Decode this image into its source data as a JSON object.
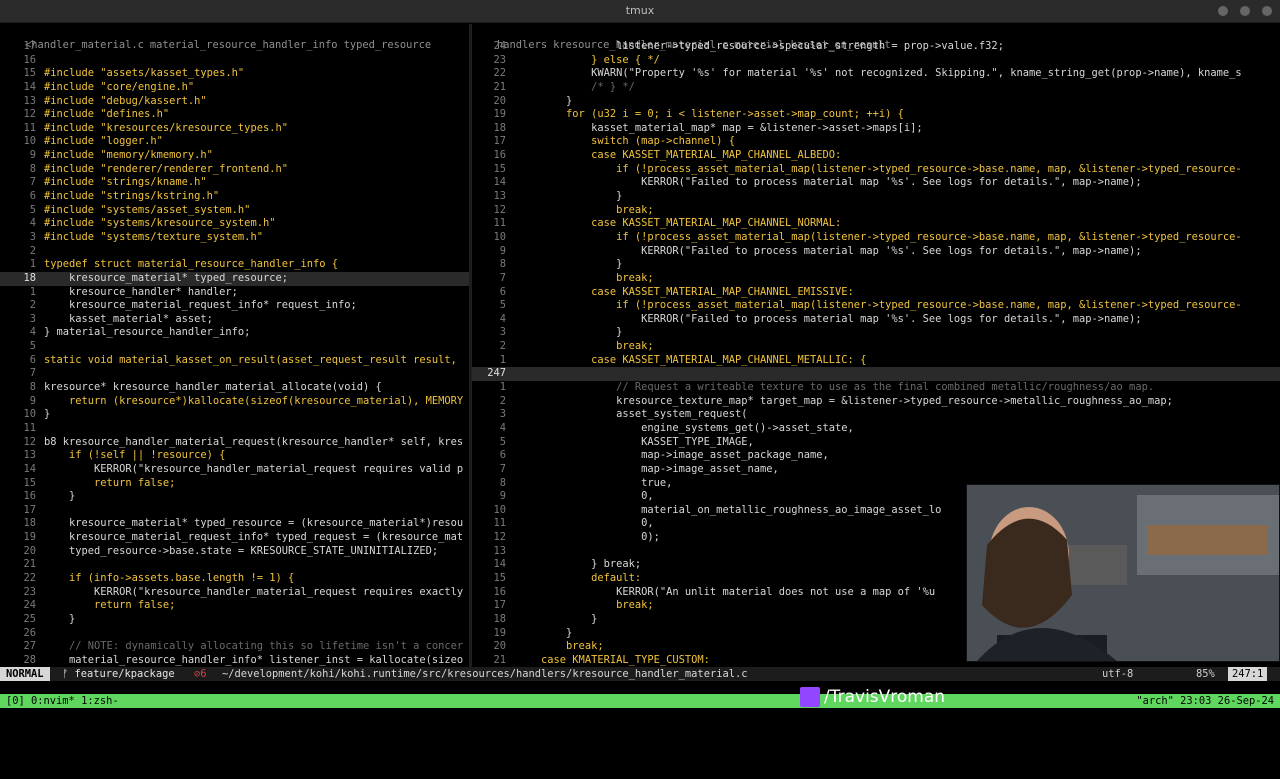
{
  "window": {
    "title": "tmux"
  },
  "left_pane": {
    "breadcrumbs": [
      "<handler_material.c",
      "material_resource_handler_info",
      "typed_resource"
    ],
    "lines": [
      {
        "n": "17",
        "t": ""
      },
      {
        "n": "16",
        "t": ""
      },
      {
        "n": "15",
        "t": "#include \"assets/kasset_types.h\""
      },
      {
        "n": "14",
        "t": "#include \"core/engine.h\""
      },
      {
        "n": "13",
        "t": "#include \"debug/kassert.h\""
      },
      {
        "n": "12",
        "t": "#include \"defines.h\""
      },
      {
        "n": "11",
        "t": "#include \"kresources/kresource_types.h\""
      },
      {
        "n": "10",
        "t": "#include \"logger.h\""
      },
      {
        "n": "9",
        "t": "#include \"memory/kmemory.h\""
      },
      {
        "n": "8",
        "t": "#include \"renderer/renderer_frontend.h\""
      },
      {
        "n": "7",
        "t": "#include \"strings/kname.h\""
      },
      {
        "n": "6",
        "t": "#include \"strings/kstring.h\""
      },
      {
        "n": "5",
        "t": "#include \"systems/asset_system.h\""
      },
      {
        "n": "4",
        "t": "#include \"systems/kresource_system.h\""
      },
      {
        "n": "3",
        "t": "#include \"systems/texture_system.h\""
      },
      {
        "n": "2",
        "t": ""
      },
      {
        "n": "1",
        "t": "typedef struct material_resource_handler_info {"
      },
      {
        "n": "18",
        "t": "    kresource_material* typed_resource;",
        "cur": true
      },
      {
        "n": "1",
        "t": "    kresource_handler* handler;"
      },
      {
        "n": "2",
        "t": "    kresource_material_request_info* request_info;"
      },
      {
        "n": "3",
        "t": "    kasset_material* asset;"
      },
      {
        "n": "4",
        "t": "} material_resource_handler_info;"
      },
      {
        "n": "5",
        "t": ""
      },
      {
        "n": "6",
        "t": "static void material_kasset_on_result(asset_request_result result,"
      },
      {
        "n": "7",
        "t": ""
      },
      {
        "n": "8",
        "t": "kresource* kresource_handler_material_allocate(void) {"
      },
      {
        "n": "9",
        "t": "    return (kresource*)kallocate(sizeof(kresource_material), MEMORY"
      },
      {
        "n": "10",
        "t": "}"
      },
      {
        "n": "11",
        "t": ""
      },
      {
        "n": "12",
        "t": "b8 kresource_handler_material_request(kresource_handler* self, kres"
      },
      {
        "n": "13",
        "t": "    if (!self || !resource) {"
      },
      {
        "n": "14",
        "t": "        KERROR(\"kresource_handler_material_request requires valid p"
      },
      {
        "n": "15",
        "t": "        return false;"
      },
      {
        "n": "16",
        "t": "    }"
      },
      {
        "n": "17",
        "t": ""
      },
      {
        "n": "18",
        "t": "    kresource_material* typed_resource = (kresource_material*)resou"
      },
      {
        "n": "19",
        "t": "    kresource_material_request_info* typed_request = (kresource_mat"
      },
      {
        "n": "20",
        "t": "    typed_resource->base.state = KRESOURCE_STATE_UNINITIALIZED;"
      },
      {
        "n": "21",
        "t": ""
      },
      {
        "n": "22",
        "t": "    if (info->assets.base.length != 1) {"
      },
      {
        "n": "23",
        "t": "        KERROR(\"kresource_handler_material_request requires exactly"
      },
      {
        "n": "24",
        "t": "        return false;"
      },
      {
        "n": "25",
        "t": "    }"
      },
      {
        "n": "26",
        "t": ""
      },
      {
        "n": "27",
        "t": "    // NOTE: dynamically allocating this so lifetime isn't a concer",
        "cm": true
      },
      {
        "n": "28",
        "t": "    material_resource_handler_info* listener_inst = kallocate(sizeo"
      }
    ]
  },
  "right_pane": {
    "breadcrumbs": [
      "handlers",
      "kresource_handler_material.c",
      "material_kasset_on_result"
    ],
    "lines": [
      {
        "n": "24",
        "t": "                listener->typed_resource->specular_strength = prop->value.f32;"
      },
      {
        "n": "23",
        "t": "            } else { */"
      },
      {
        "n": "22",
        "t": "            KWARN(\"Property '%s' for material '%s' not recognized. Skipping.\", kname_string_get(prop->name), kname_s"
      },
      {
        "n": "21",
        "t": "            /* } */",
        "cm": true
      },
      {
        "n": "20",
        "t": "        }"
      },
      {
        "n": "19",
        "t": "        for (u32 i = 0; i < listener->asset->map_count; ++i) {"
      },
      {
        "n": "18",
        "t": "            kasset_material_map* map = &listener->asset->maps[i];"
      },
      {
        "n": "17",
        "t": "            switch (map->channel) {"
      },
      {
        "n": "16",
        "t": "            case KASSET_MATERIAL_MAP_CHANNEL_ALBEDO:"
      },
      {
        "n": "15",
        "t": "                if (!process_asset_material_map(listener->typed_resource->base.name, map, &listener->typed_resource-"
      },
      {
        "n": "14",
        "t": "                    KERROR(\"Failed to process material map '%s'. See logs for details.\", map->name);"
      },
      {
        "n": "13",
        "t": "                }"
      },
      {
        "n": "12",
        "t": "                break;"
      },
      {
        "n": "11",
        "t": "            case KASSET_MATERIAL_MAP_CHANNEL_NORMAL:"
      },
      {
        "n": "10",
        "t": "                if (!process_asset_material_map(listener->typed_resource->base.name, map, &listener->typed_resource-"
      },
      {
        "n": "9",
        "t": "                    KERROR(\"Failed to process material map '%s'. See logs for details.\", map->name);"
      },
      {
        "n": "8",
        "t": "                }"
      },
      {
        "n": "7",
        "t": "                break;"
      },
      {
        "n": "6",
        "t": "            case KASSET_MATERIAL_MAP_CHANNEL_EMISSIVE:"
      },
      {
        "n": "5",
        "t": "                if (!process_asset_material_map(listener->typed_resource->base.name, map, &listener->typed_resource-"
      },
      {
        "n": "4",
        "t": "                    KERROR(\"Failed to process material map '%s'. See logs for details.\", map->name);"
      },
      {
        "n": "3",
        "t": "                }"
      },
      {
        "n": "2",
        "t": "                break;"
      },
      {
        "n": "1",
        "t": "            case KASSET_MATERIAL_MAP_CHANNEL_METALLIC: {"
      },
      {
        "n": "247",
        "t": "",
        "cur": true
      },
      {
        "n": "1",
        "t": "                // Request a writeable texture to use as the final combined metallic/roughness/ao map.",
        "cm": true
      },
      {
        "n": "2",
        "t": "                kresource_texture_map* target_map = &listener->typed_resource->metallic_roughness_ao_map;",
        "hl": "texture_map"
      },
      {
        "n": "3",
        "t": "                asset_system_request("
      },
      {
        "n": "4",
        "t": "                    engine_systems_get()->asset_state,"
      },
      {
        "n": "5",
        "t": "                    KASSET_TYPE_IMAGE,"
      },
      {
        "n": "6",
        "t": "                    map->image_asset_package_name,"
      },
      {
        "n": "7",
        "t": "                    map->image_asset_name,"
      },
      {
        "n": "8",
        "t": "                    true,"
      },
      {
        "n": "9",
        "t": "                    0,"
      },
      {
        "n": "10",
        "t": "                    material_on_metallic_roughness_ao_image_asset_lo"
      },
      {
        "n": "11",
        "t": "                    0,"
      },
      {
        "n": "12",
        "t": "                    0);"
      },
      {
        "n": "13",
        "t": ""
      },
      {
        "n": "14",
        "t": "            } break;"
      },
      {
        "n": "15",
        "t": "            default:"
      },
      {
        "n": "16",
        "t": "                KERROR(\"An unlit material does not use a map of '%u"
      },
      {
        "n": "17",
        "t": "                break;"
      },
      {
        "n": "18",
        "t": "            }"
      },
      {
        "n": "19",
        "t": "        }"
      },
      {
        "n": "20",
        "t": "        break;"
      },
      {
        "n": "21",
        "t": "    case KMATERIAL_TYPE_CUSTOM:"
      }
    ]
  },
  "statusline": {
    "mode": "NORMAL",
    "branch": "ᚠ feature/kpackage",
    "errors": "⊘6",
    "path": "~/development/kohi/kohi.runtime/src/kresources/handlers/kresource_handler_material.c",
    "encoding": "utf-8",
    "percent": "85%",
    "position": "247:1"
  },
  "tmux": {
    "windows": "[0] 0:nvim* 1:zsh-",
    "right": "\"arch\" 23:03 26-Sep-24"
  },
  "overlay": {
    "twitch_handle": "/TravisVroman"
  },
  "colors": {
    "accent_yellow": "#f0c33c",
    "tmux_green": "#5fd75f",
    "search_highlight": "#f0a020"
  }
}
